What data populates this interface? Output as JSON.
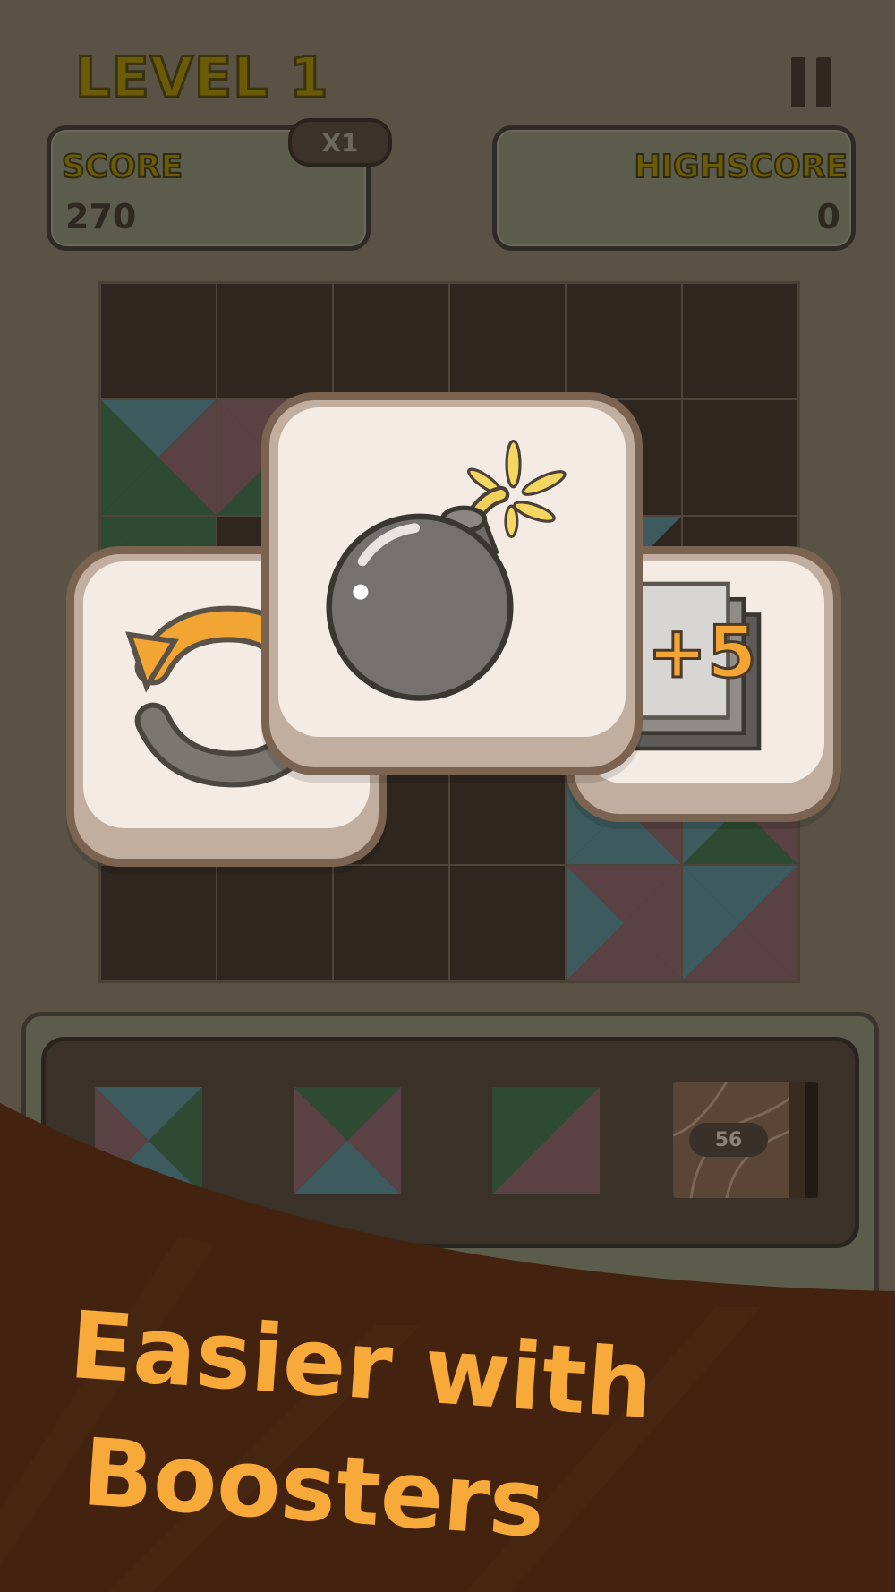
{
  "header": {
    "level_title": "LEVEL 1",
    "pause_icon": "pause-icon"
  },
  "score_panel": {
    "label": "SCORE",
    "value": "270",
    "multiplier": "X1"
  },
  "highscore_panel": {
    "label": "HIGHSCORE",
    "value": "0"
  },
  "boosters": [
    {
      "name": "undo",
      "icon": "undo-icon"
    },
    {
      "name": "bomb",
      "icon": "bomb-icon"
    },
    {
      "name": "extra-pieces",
      "icon": "extra-pieces-icon",
      "label": "+5"
    }
  ],
  "tray": {
    "deck_count": "56"
  },
  "banner": {
    "line1": "Easier with",
    "line2": "Boosters"
  },
  "colors": {
    "background": "#5b5246",
    "board_empty": "#2f2620",
    "tile_teal": "#3d5a5e",
    "tile_green": "#2e4a32",
    "tile_maroon": "#5a4244",
    "accent_orange": "#f7a93a",
    "banner_brown": "#43230f"
  }
}
